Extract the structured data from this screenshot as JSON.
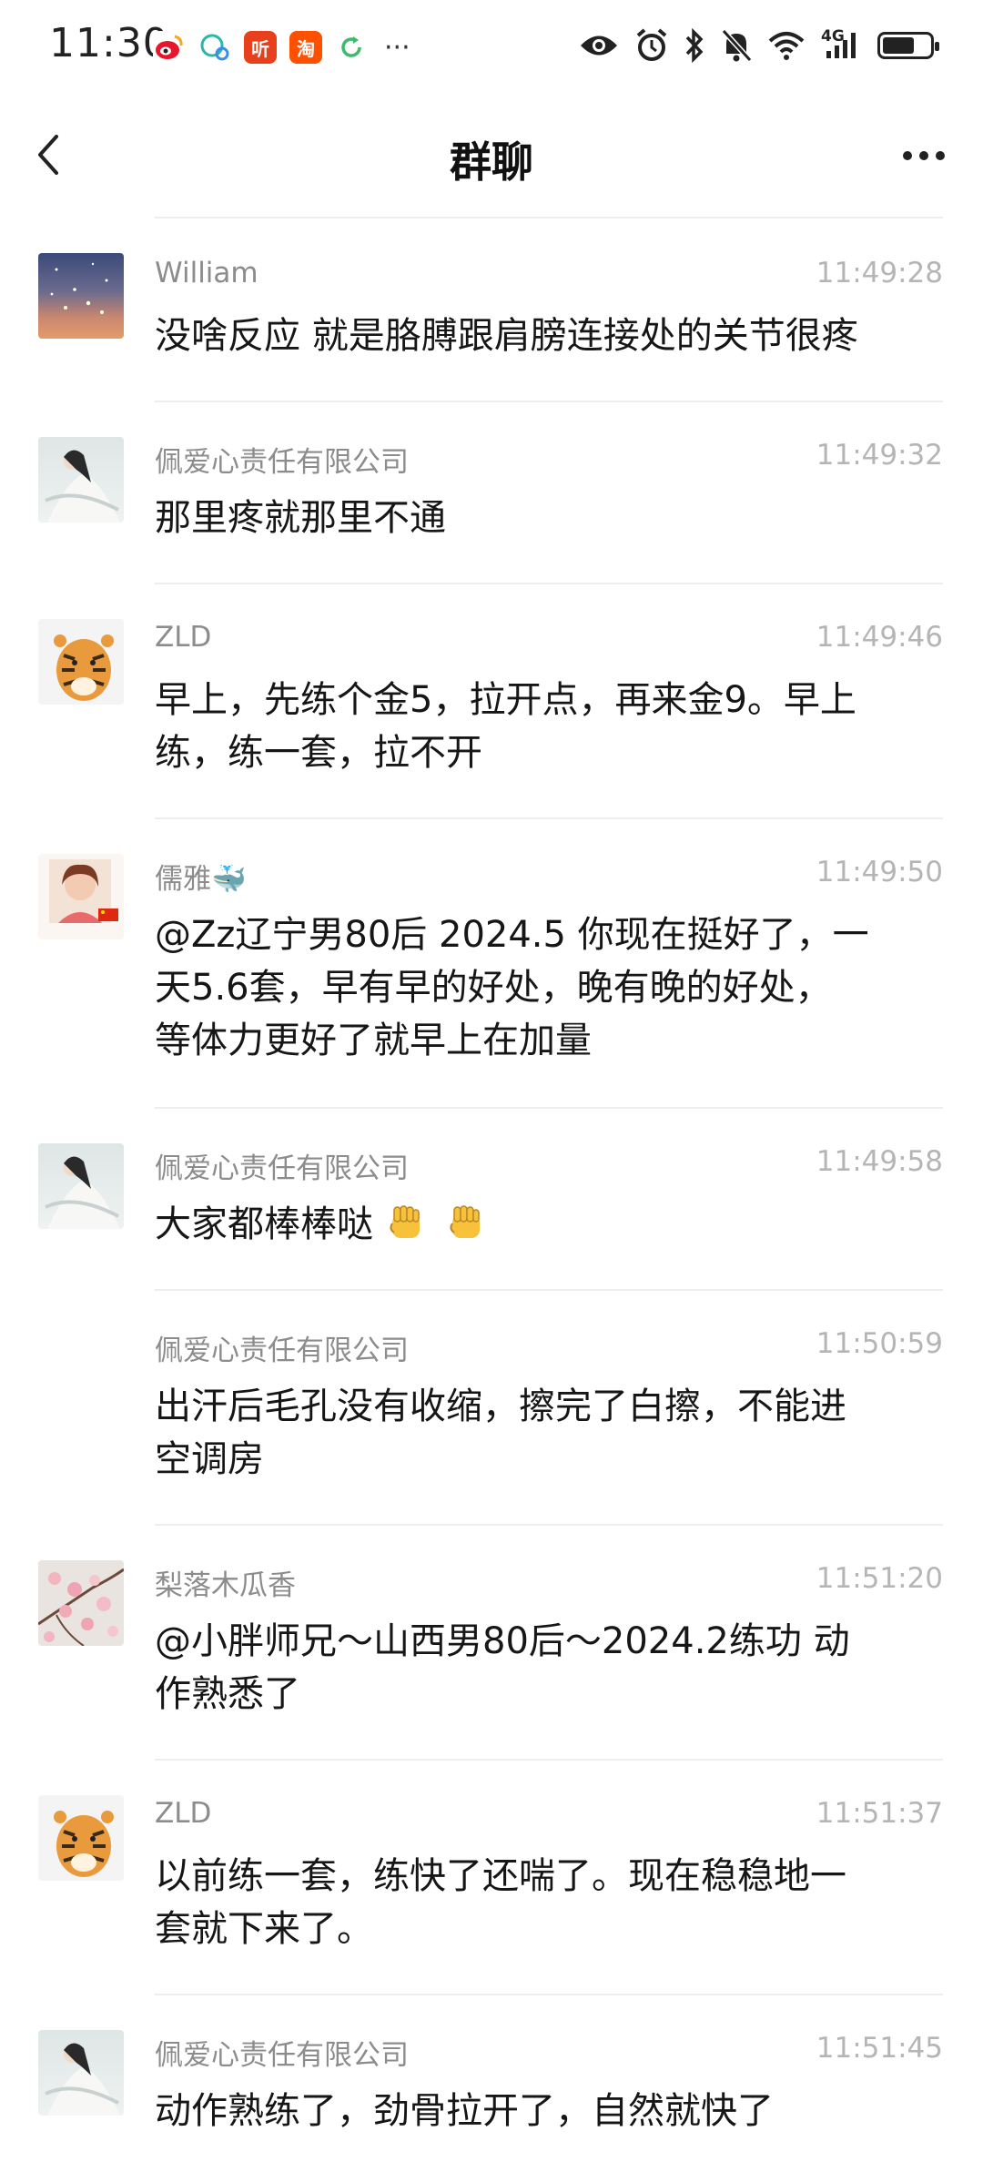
{
  "status_bar": {
    "time": "11:30",
    "app_icons": [
      {
        "icon": "weibo-icon",
        "label": "",
        "color": "#f5a623"
      },
      {
        "icon": "chat-bubble-icon",
        "label": "",
        "color": "#2ab7a9"
      },
      {
        "icon": "ting-app-icon",
        "label": "听",
        "color": "#e8401c"
      },
      {
        "icon": "taobao-icon",
        "label": "淘",
        "color": "#ff5000"
      },
      {
        "icon": "refresh-icon",
        "label": "",
        "color": "#3dbb6b"
      }
    ],
    "overflow_dots": "···",
    "network_label": "4G"
  },
  "header": {
    "title": "群聊"
  },
  "messages": [
    {
      "sender": "William",
      "time": "11:49:28",
      "avatar": "night-sky-avatar",
      "lines": [
        "没啥反应 就是胳膊跟肩膀连接处的关节很疼"
      ]
    },
    {
      "sender": "佩爱心责任有限公司",
      "time": "11:49:32",
      "avatar": "woman-in-white-avatar",
      "lines": [
        "那里疼就那里不通"
      ]
    },
    {
      "sender": "ZLD",
      "time": "11:49:46",
      "avatar": "tiger-avatar",
      "lines": [
        "早上，先练个金5，拉开点，再来金9。早上",
        "练，练一套，拉不开"
      ]
    },
    {
      "sender": "儒雅🐳",
      "time": "11:49:50",
      "avatar": "woman-portrait-avatar",
      "lines": [
        "@Zz辽宁男80后 2024.5 你现在挺好了，一",
        "天5.6套，早有早的好处，晚有晚的好处，",
        "等体力更好了就早上在加量"
      ]
    },
    {
      "sender": "佩爱心责任有限公司",
      "time": "11:49:58",
      "avatar": "woman-in-white-avatar",
      "lines": [
        "大家都棒棒哒"
      ]
    },
    {
      "sender": "佩爱心责任有限公司",
      "time": "11:50:59",
      "avatar": "",
      "lines": [
        "出汗后毛孔没有收缩，擦完了白擦，不能进",
        "空调房"
      ]
    },
    {
      "sender": "梨落木瓜香",
      "time": "11:51:20",
      "avatar": "blossom-avatar",
      "lines": [
        "@小胖师兄～山西男80后～2024.2练功 动",
        "作熟悉了"
      ]
    },
    {
      "sender": "ZLD",
      "time": "11:51:37",
      "avatar": "tiger-avatar",
      "lines": [
        "以前练一套，练快了还喘了。现在稳稳地一",
        "套就下来了。"
      ]
    },
    {
      "sender": "佩爱心责任有限公司",
      "time": "11:51:45",
      "avatar": "woman-in-white-avatar",
      "lines": [
        "动作熟练了，劲骨拉开了，自然就快了"
      ]
    }
  ]
}
